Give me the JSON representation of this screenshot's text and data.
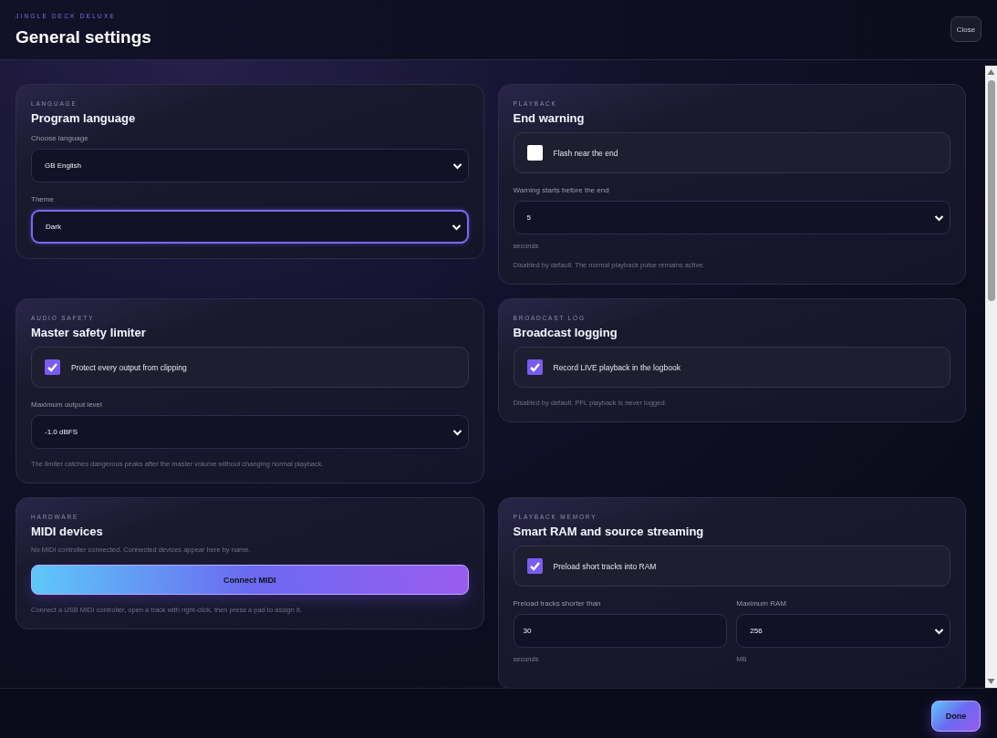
{
  "header": {
    "app_name": "JINGLE DECK DELUXE",
    "title": "General settings",
    "close_label": "Close"
  },
  "cards": [
    {
      "eyebrow": "LANGUAGE",
      "title": "Program language",
      "blocks": [
        {
          "kind": "select",
          "label": "Choose language",
          "value": "GB English",
          "focused": false
        },
        {
          "kind": "select",
          "label": "Theme",
          "value": "Dark",
          "focused": true
        }
      ]
    },
    {
      "eyebrow": "PLAYBACK",
      "title": "End warning",
      "blocks": [
        {
          "kind": "checkbox",
          "label": "Flash near the end",
          "checked": false
        },
        {
          "kind": "select",
          "label": "Warning starts before the end",
          "value": "5",
          "focused": false,
          "unit": "seconds"
        },
        {
          "kind": "note",
          "text": "Disabled by default. The normal playback pulse remains active."
        }
      ]
    },
    {
      "eyebrow": "AUDIO SAFETY",
      "title": "Master safety limiter",
      "blocks": [
        {
          "kind": "checkbox",
          "label": "Protect every output from clipping",
          "checked": true
        },
        {
          "kind": "select",
          "label": "Maximum output level",
          "value": "-1.0 dBFS",
          "focused": false
        },
        {
          "kind": "note",
          "text": "The limiter catches dangerous peaks after the master volume without changing normal playback."
        }
      ]
    },
    {
      "eyebrow": "BROADCAST LOG",
      "title": "Broadcast logging",
      "blocks": [
        {
          "kind": "checkbox",
          "label": "Record LIVE playback in the logbook",
          "checked": true
        },
        {
          "kind": "note",
          "text": "Disabled by default. PFL playback is never logged."
        }
      ]
    },
    {
      "eyebrow": "HARDWARE",
      "title": "MIDI devices",
      "blocks": [
        {
          "kind": "note",
          "text": "No MIDI controller connected. Connected devices appear here by name."
        },
        {
          "kind": "button",
          "label": "Connect MIDI"
        },
        {
          "kind": "note",
          "text": "Connect a USB MIDI controller, open a track with right-click, then press a pad to assign it."
        }
      ]
    },
    {
      "eyebrow": "PLAYBACK MEMORY",
      "title": "Smart RAM and source streaming",
      "blocks": [
        {
          "kind": "checkbox",
          "label": "Preload short tracks into RAM",
          "checked": true
        },
        {
          "kind": "pair",
          "fields": [
            {
              "kind": "input",
              "label": "Preload tracks shorter than",
              "value": "30",
              "unit": "seconds"
            },
            {
              "kind": "select",
              "label": "Maximum RAM",
              "value": "256",
              "focused": false,
              "unit": "MB"
            }
          ]
        }
      ]
    }
  ],
  "footer": {
    "done_label": "Done"
  }
}
